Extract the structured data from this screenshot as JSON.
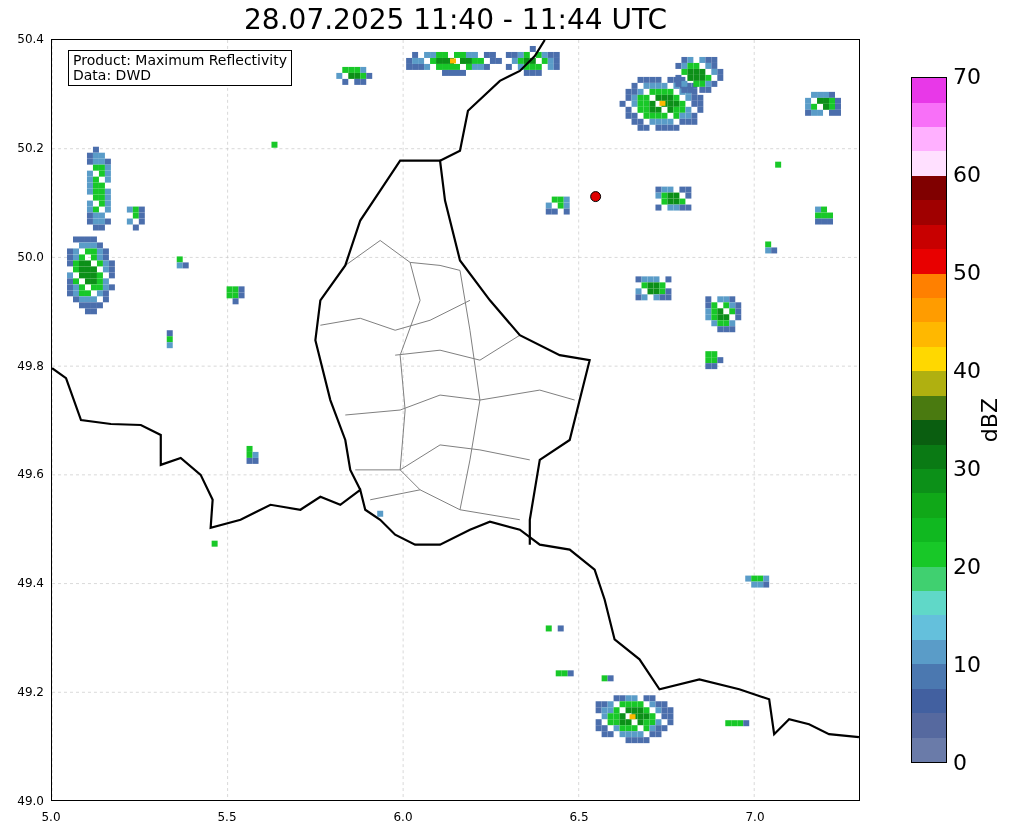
{
  "title": "28.07.2025 11:40 - 11:44 UTC",
  "info_box": {
    "lines": [
      "Product: Maximum Reflectivity",
      "Data: DWD"
    ]
  },
  "y_ticks": [
    "50.4",
    "50.2",
    "50.0",
    "49.8",
    "49.6",
    "49.4",
    "49.2",
    "49.0"
  ],
  "x_ticks": [
    "5.0",
    "5.5",
    "6.0",
    "6.5",
    "7.0"
  ],
  "colorbar": {
    "label": "dBZ",
    "ticks": [
      "70",
      "60",
      "50",
      "40",
      "30",
      "20",
      "10",
      "0"
    ],
    "segments": [
      {
        "color": "#6a7ba9"
      },
      {
        "color": "#56699f"
      },
      {
        "color": "#4260a0"
      },
      {
        "color": "#4b78b0"
      },
      {
        "color": "#5a9cc8"
      },
      {
        "color": "#64c0dc"
      },
      {
        "color": "#60d8c8"
      },
      {
        "color": "#40d070"
      },
      {
        "color": "#18c828"
      },
      {
        "color": "#10b820"
      },
      {
        "color": "#10a818"
      },
      {
        "color": "#0c9018"
      },
      {
        "color": "#0a7a14"
      },
      {
        "color": "#0a5e10"
      },
      {
        "color": "#4a7a10"
      },
      {
        "color": "#b0b010"
      },
      {
        "color": "#ffd800"
      },
      {
        "color": "#ffb800"
      },
      {
        "color": "#ff9c00"
      },
      {
        "color": "#ff8000"
      },
      {
        "color": "#e80000"
      },
      {
        "color": "#c80000"
      },
      {
        "color": "#a00000"
      },
      {
        "color": "#800000"
      },
      {
        "color": "#ffe0ff"
      },
      {
        "color": "#ffb0ff"
      },
      {
        "color": "#f870f8"
      },
      {
        "color": "#e838e8"
      }
    ]
  }
}
